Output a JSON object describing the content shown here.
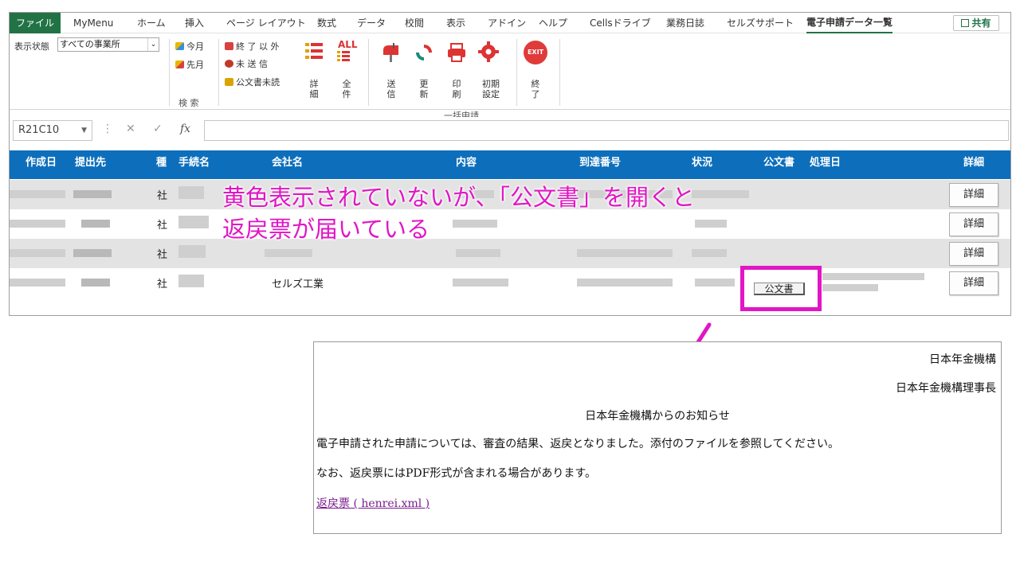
{
  "ribbon_tabs": [
    "ファイル",
    "MyMenu",
    "ホーム",
    "挿入",
    "ページ レイアウト",
    "数式",
    "データ",
    "校閲",
    "表示",
    "アドイン",
    "ヘルプ",
    "Cellsドライブ",
    "業務日誌",
    "セルズサポート",
    "電子申請データ一覧"
  ],
  "share_label": "共有",
  "ribbon": {
    "display_state_label": "表示状態",
    "office_select": "すべての事業所",
    "this_month": "今月",
    "last_month": "先月",
    "not_finished": "終 了 以 外",
    "not_sent": "未 送 信",
    "unread_doc": "公文書未読",
    "detail": "詳\n細",
    "all_label": "ALL",
    "all_items": "全\n件",
    "search_group": "検 索",
    "send": "送\n信",
    "update": "更\n新",
    "print": "印\n刷",
    "init_settings": "初期\n設定",
    "bulk_group": "一括申請",
    "exit_icon_text": "EXIT",
    "exit": "終\n了"
  },
  "formula_bar": {
    "cell_ref": "R21C10",
    "fx": "fx"
  },
  "table": {
    "headers": [
      "作成日",
      "提出先",
      "種",
      "手続名",
      "会社名",
      "内容",
      "到達番号",
      "状況",
      "公文書",
      "処理日",
      "詳細"
    ],
    "rows": [
      {
        "type": "社",
        "company": "",
        "detail": "詳細"
      },
      {
        "type": "社",
        "company": "",
        "detail": "詳細"
      },
      {
        "type": "社",
        "company": "",
        "detail": "詳細"
      },
      {
        "type": "社",
        "company": "セルズ工業",
        "official_doc": "公文書",
        "detail": "詳細"
      }
    ]
  },
  "annotation": {
    "line1": "黄色表示されていないが、「公文書」を開くと",
    "line2": "返戻票が届いている",
    "color": "#e116c5"
  },
  "document": {
    "org": "日本年金機構",
    "director": "日本年金機構理事長",
    "title": "日本年金機構からのお知らせ",
    "body1": "電子申請された申請については、審査の結果、返戻となりました。添付のファイルを参照してください。",
    "body2": "なお、返戻票にはPDF形式が含まれる場合があります。",
    "link": "返戻票 ( henrei.xml )"
  }
}
